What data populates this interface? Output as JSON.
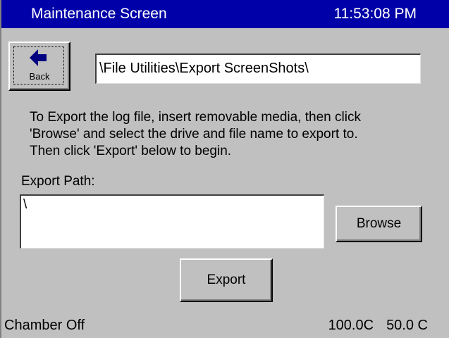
{
  "header": {
    "title": "Maintenance Screen",
    "time": "11:53:08 PM"
  },
  "nav": {
    "back_label": "Back",
    "back_icon": "left-arrow-icon",
    "current_path": "\\File Utilities\\Export ScreenShots\\"
  },
  "instructions": {
    "line1": "To Export the log file, insert removable media, then click",
    "line2": "'Browse' and select the drive and file name to export to.",
    "line3": "Then click 'Export' below to begin."
  },
  "export_path": {
    "label": "Export Path:",
    "value": "\\"
  },
  "buttons": {
    "browse_label": "Browse",
    "export_label": "Export"
  },
  "status": {
    "chamber": "Chamber Off",
    "temp1": "100.0C",
    "temp2": "50.0 C"
  },
  "colors": {
    "title_bar": "#0000a8",
    "background": "#c0c0c0",
    "arrow": "#000080"
  }
}
